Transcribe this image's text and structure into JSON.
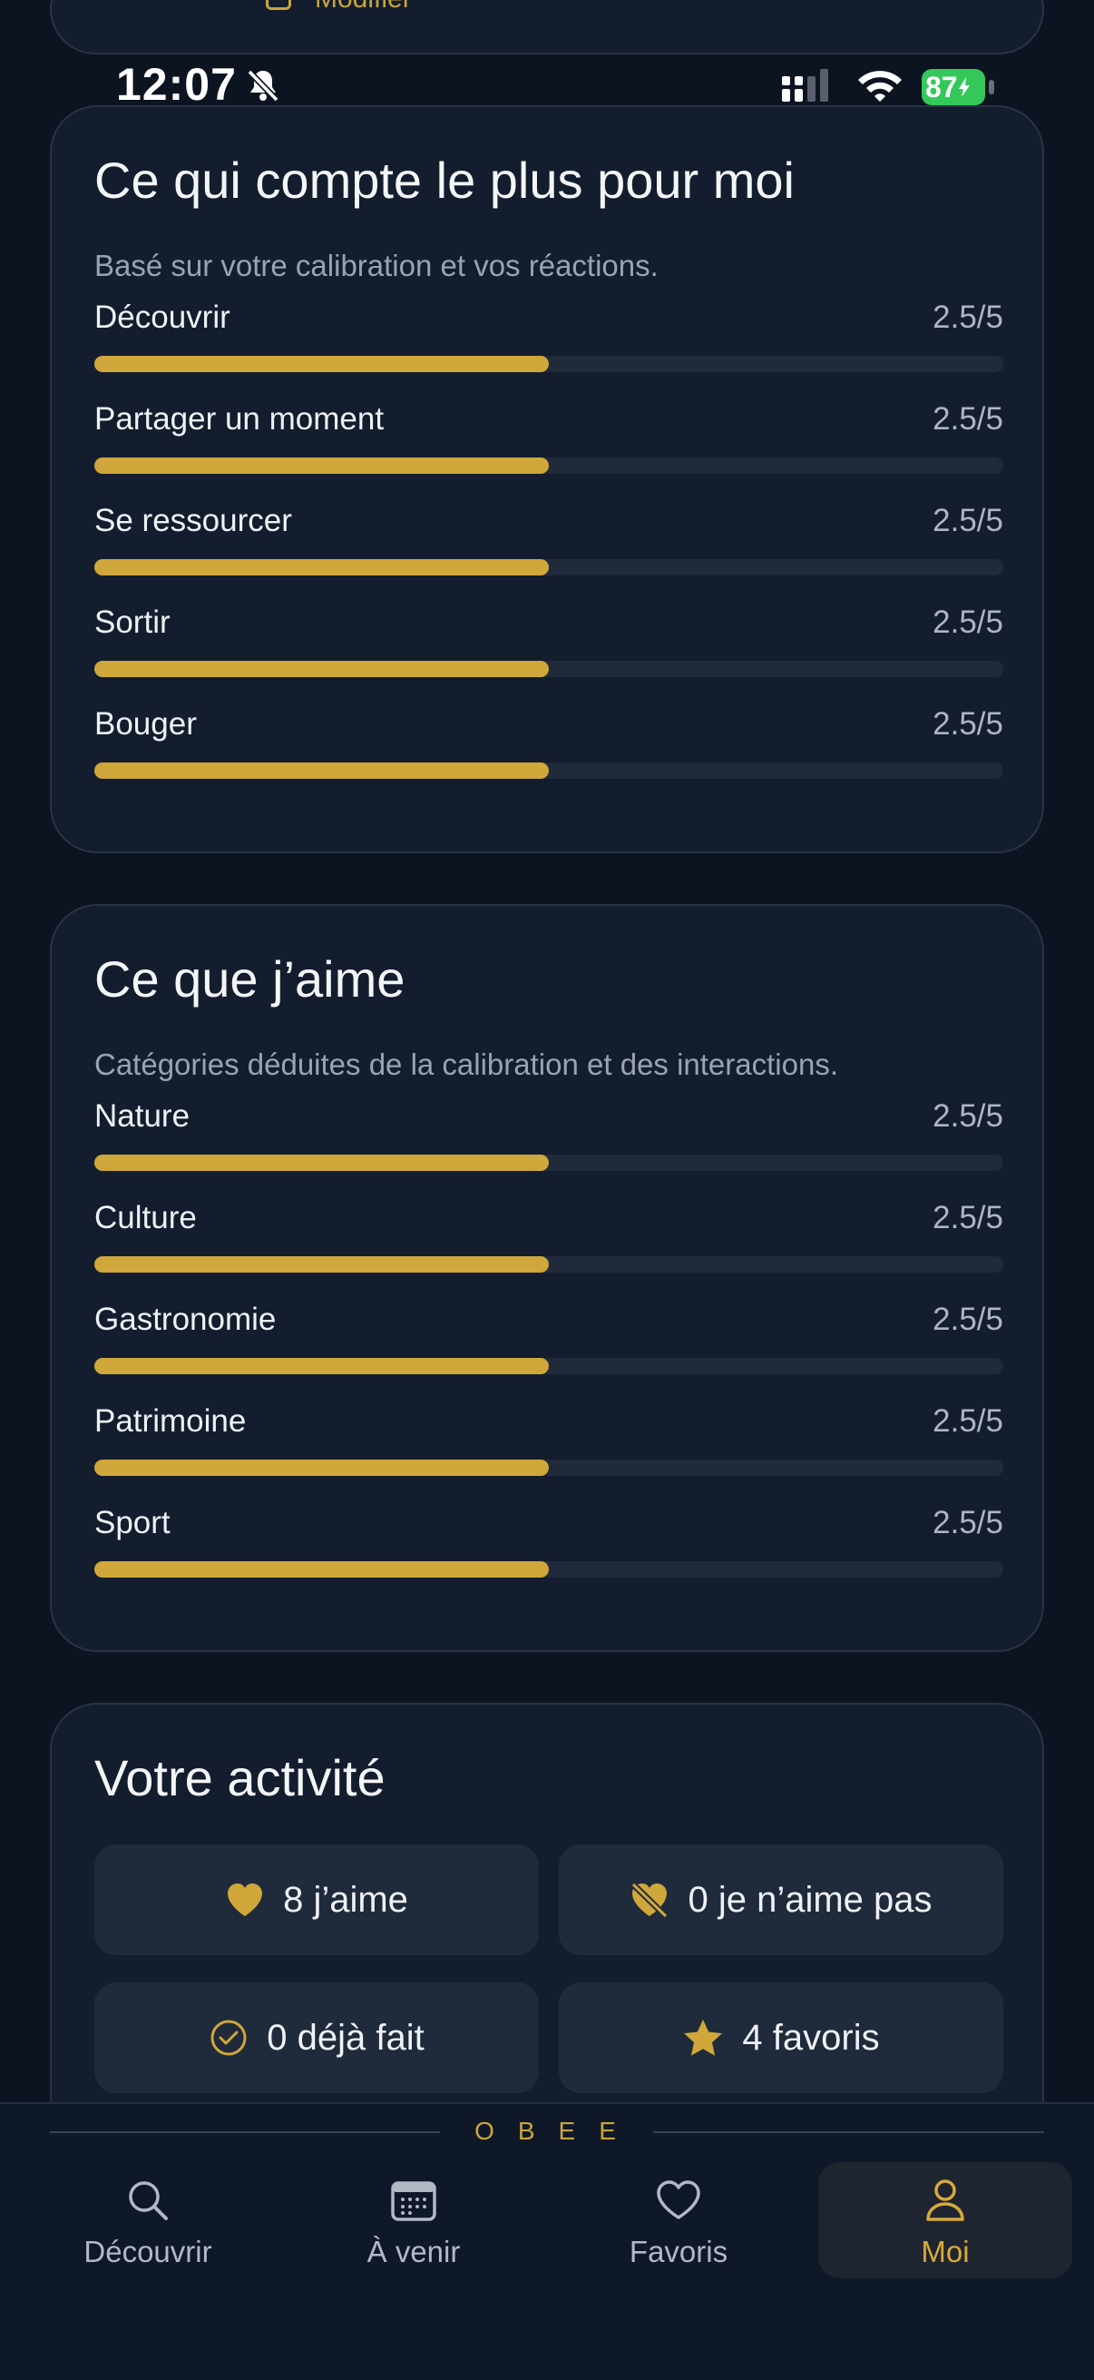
{
  "top_card": {
    "edit_label": "Modifier"
  },
  "status_bar": {
    "time": "12:07",
    "battery": "87"
  },
  "priorities": {
    "title": "Ce qui compte le plus pour moi",
    "subtitle": "Basé sur votre calibration et vos réactions.",
    "items": [
      {
        "label": "Découvrir",
        "value": "2.5/5",
        "score": 2.5
      },
      {
        "label": "Partager un moment",
        "value": "2.5/5",
        "score": 2.5
      },
      {
        "label": "Se ressourcer",
        "value": "2.5/5",
        "score": 2.5
      },
      {
        "label": "Sortir",
        "value": "2.5/5",
        "score": 2.5
      },
      {
        "label": "Bouger",
        "value": "2.5/5",
        "score": 2.5
      }
    ]
  },
  "likes": {
    "title": "Ce que j’aime",
    "subtitle": "Catégories déduites de la calibration et des interactions.",
    "items": [
      {
        "label": "Nature",
        "value": "2.5/5",
        "score": 2.5
      },
      {
        "label": "Culture",
        "value": "2.5/5",
        "score": 2.5
      },
      {
        "label": "Gastronomie",
        "value": "2.5/5",
        "score": 2.5
      },
      {
        "label": "Patrimoine",
        "value": "2.5/5",
        "score": 2.5
      },
      {
        "label": "Sport",
        "value": "2.5/5",
        "score": 2.5
      }
    ]
  },
  "activity": {
    "title": "Votre activité",
    "likes": "8 j’aime",
    "dislikes": "0 je n’aime pas",
    "done": "0 déjà fait",
    "favorites": "4 favoris"
  },
  "nav": {
    "brand": "OBEE",
    "items": [
      {
        "label": "Découvrir",
        "icon": "search-icon"
      },
      {
        "label": "À venir",
        "icon": "calendar-icon"
      },
      {
        "label": "Favoris",
        "icon": "heart-icon"
      },
      {
        "label": "Moi",
        "icon": "user-icon",
        "active": true
      }
    ]
  },
  "colors": {
    "accent": "#cfa73a",
    "background": "#0c1421",
    "card": "#131d2e",
    "battery": "#34c759"
  }
}
